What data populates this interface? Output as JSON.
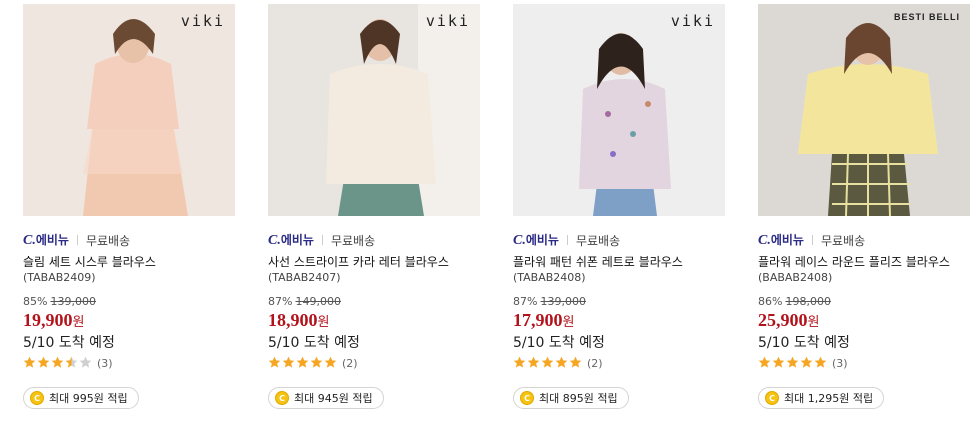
{
  "products": [
    {
      "brand_mark": "viki",
      "seller": {
        "logo_letter": "C.",
        "logo_text": "에비뉴",
        "shipping": "무료배송"
      },
      "name": "슬림 세트 시스루 블라우스",
      "code": "(TABAB2409)",
      "discount": "85%",
      "original_price": "139,000",
      "price": "19,900",
      "price_unit": "원",
      "arrival": "5/10 도착 예정",
      "rating": 3.5,
      "review_count": "(3)",
      "reward": "최대 995원 적립",
      "image": {
        "bg": "#efe4dc",
        "accent": "#f3cfc0"
      }
    },
    {
      "brand_mark": "viki",
      "seller": {
        "logo_letter": "C.",
        "logo_text": "에비뉴",
        "shipping": "무료배송"
      },
      "name": "사선 스트라이프 카라 레터 블라우스",
      "code": "(TABAB2407)",
      "discount": "87%",
      "original_price": "149,000",
      "price": "18,900",
      "price_unit": "원",
      "arrival": "5/10 도착 예정",
      "rating": 5,
      "review_count": "(2)",
      "reward": "최대 945원 적립",
      "image": {
        "bg": "#e9e6e2",
        "accent": "#f1e8de"
      }
    },
    {
      "brand_mark": "viki",
      "seller": {
        "logo_letter": "C.",
        "logo_text": "에비뉴",
        "shipping": "무료배송"
      },
      "name": "플라워 패턴 쉬폰 레트로 블라우스",
      "code": "(TABAB2408)",
      "discount": "87%",
      "original_price": "139,000",
      "price": "17,900",
      "price_unit": "원",
      "arrival": "5/10 도착 예정",
      "rating": 5,
      "review_count": "(2)",
      "reward": "최대 895원 적립",
      "image": {
        "bg": "#ececec",
        "accent": "#d9c8d6"
      }
    },
    {
      "brand_mark": "BESTI BELLI",
      "seller": {
        "logo_letter": "C.",
        "logo_text": "에비뉴",
        "shipping": "무료배송"
      },
      "name": "플라워 레이스 라운드 플리즈 블라우스",
      "code": "(BABAB2408)",
      "discount": "86%",
      "original_price": "198,000",
      "price": "25,900",
      "price_unit": "원",
      "arrival": "5/10 도착 예정",
      "rating": 5,
      "review_count": "(3)",
      "reward": "최대 1,295원 적립",
      "image": {
        "bg": "#d9d6d2",
        "accent": "#f2e59a"
      }
    }
  ],
  "colors": {
    "price": "#b3121b",
    "seller": "#2b2b86",
    "star": "#f5a623",
    "coin": "#f6c312"
  }
}
